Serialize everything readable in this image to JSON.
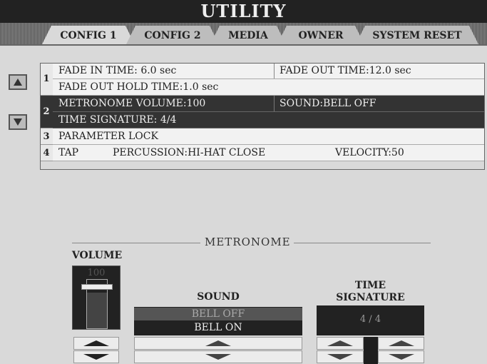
{
  "title": "UTILITY",
  "tabs": [
    {
      "label": "CONFIG 1",
      "active": true
    },
    {
      "label": "CONFIG 2",
      "active": false
    },
    {
      "label": "MEDIA",
      "active": false
    },
    {
      "label": "OWNER",
      "active": false
    },
    {
      "label": "SYSTEM RESET",
      "active": false
    }
  ],
  "nav": {
    "up_icon": "triangle-up-icon",
    "down_icon": "triangle-down-icon"
  },
  "list": {
    "num1": "1",
    "num2": "2",
    "num3": "3",
    "num4": "4",
    "fade_in": "FADE IN TIME:  6.0 sec",
    "fade_out": "FADE OUT TIME:12.0 sec",
    "fade_hold": "FADE OUT HOLD TIME:1.0 sec",
    "metro_volume": "METRONOME VOLUME:100",
    "sound": "SOUND:BELL OFF",
    "time_sig": "TIME SIGNATURE:   4/4",
    "param_lock": "PARAMETER LOCK",
    "tap": "TAP",
    "percussion": "PERCUSSION:HI-HAT CLOSE",
    "velocity": "VELOCITY:50"
  },
  "metronome": {
    "section_title": "METRONOME",
    "volume_label": "VOLUME",
    "volume_value": "100",
    "volume_level": 1.0,
    "sound_label": "SOUND",
    "sound_options": [
      "BELL OFF",
      "BELL ON"
    ],
    "sound_selected": "BELL OFF",
    "time_sig_label_1": "TIME",
    "time_sig_label_2": "SIGNATURE",
    "time_sig_value": "4 / 4"
  },
  "colors": {
    "selected_row": "#333333",
    "title_bar": "#222222"
  }
}
